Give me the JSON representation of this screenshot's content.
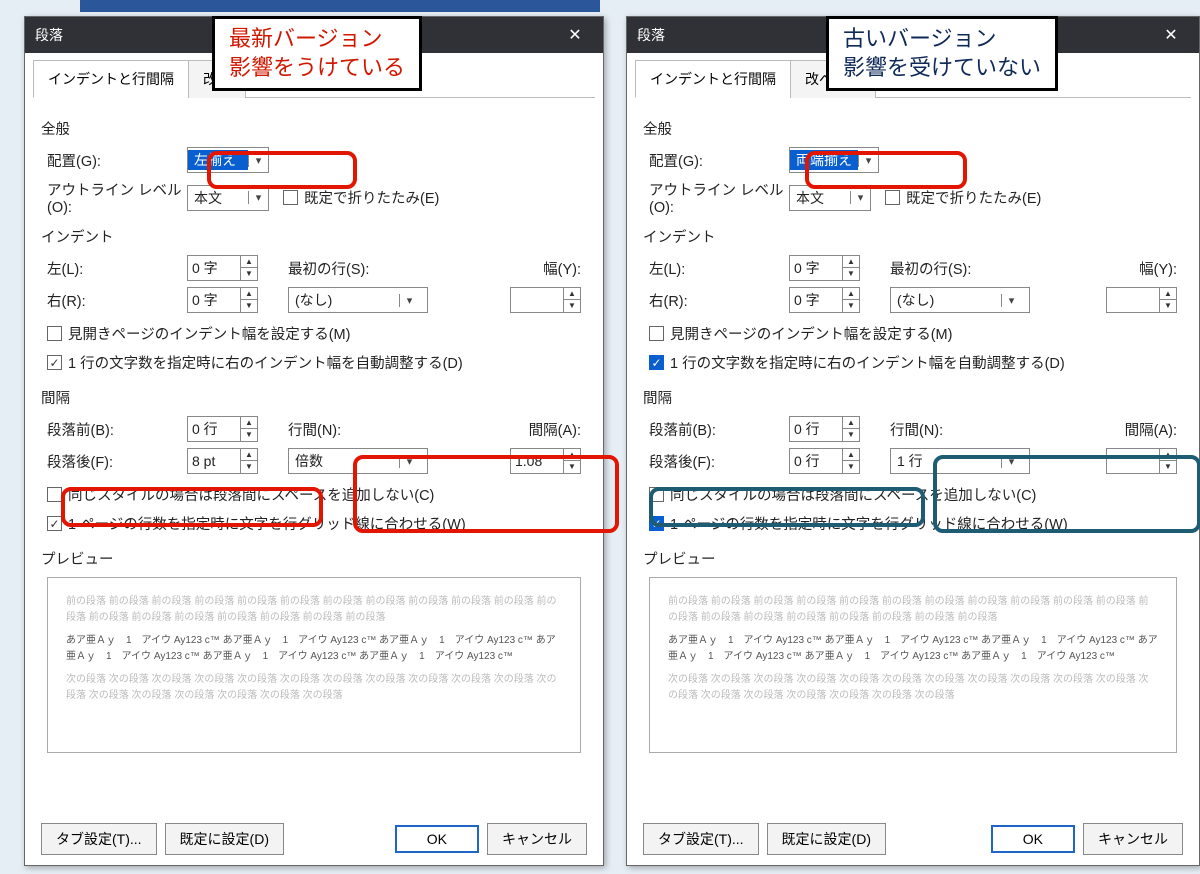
{
  "annot_left": "最新バージョン\n影響をうけている",
  "annot_right": "古いバージョン\n影響を受けていない",
  "title": "段落",
  "close_glyph": "✕",
  "tabs": {
    "t1": "インデントと行間隔",
    "t2_left": "改ぺ",
    "t2_right": "改ペーシ"
  },
  "sec": {
    "general": "全般",
    "indent": "インデント",
    "spacing": "間隔",
    "preview": "プレビュー"
  },
  "labels": {
    "align": "配置(G):",
    "outline": "アウトライン レベル(O):",
    "collapse": "既定で折りたたみ(E)",
    "left": "左(L):",
    "right": "右(R):",
    "firstline": "最初の行(S):",
    "width": "幅(Y):",
    "mirror": "見開きページのインデント幅を設定する(M)",
    "autoadjust": "1 行の文字数を指定時に右のインデント幅を自動調整する(D)",
    "before": "段落前(B):",
    "after": "段落後(F):",
    "linespace": "行間(N):",
    "interval": "間隔(A):",
    "nospace": "同じスタイルの場合は段落間にスペースを追加しない(C)",
    "snapgrid": "1 ページの行数を指定時に文字を行グリッド線に合わせる(W)"
  },
  "left": {
    "align": "左揃え",
    "outline": "本文",
    "indent_l": "0 字",
    "indent_r": "0 字",
    "firstline": "(なし)",
    "width": "",
    "before": "0 行",
    "after": "8 pt",
    "linespace": "倍数",
    "interval": "1.08",
    "chk_mirror": false,
    "chk_auto": true,
    "chk_auto_style": "gray",
    "chk_nospace": false,
    "chk_snap": true,
    "chk_snap_style": "gray",
    "chk_collapse": false
  },
  "right": {
    "align": "両端揃え",
    "outline": "本文",
    "indent_l": "0 字",
    "indent_r": "0 字",
    "firstline": "(なし)",
    "width": "",
    "before": "0 行",
    "after": "0 行",
    "linespace": "1 行",
    "interval": "",
    "chk_mirror": false,
    "chk_auto": true,
    "chk_auto_style": "blue",
    "chk_nospace": false,
    "chk_snap": true,
    "chk_snap_style": "blue",
    "chk_collapse": false
  },
  "preview": {
    "gray1": "前の段落 前の段落 前の段落 前の段落 前の段落 前の段落 前の段落 前の段落 前の段落 前の段落 前の段落 前の段落 前の段落 前の段落 前の段落 前の段落 前の段落 前の段落 前の段落",
    "dark": "あア亜Ａｙ　1　アイウ Ay123 c™ あア亜Ａｙ　1　アイウ Ay123 c™ あア亜Ａｙ　1　アイウ Ay123 c™ あア亜Ａｙ　1　アイウ Ay123 c™ あア亜Ａｙ　1　アイウ Ay123 c™ あア亜Ａｙ　1　アイウ Ay123 c™",
    "gray2": "次の段落 次の段落 次の段落 次の段落 次の段落 次の段落 次の段落 次の段落 次の段落 次の段落 次の段落 次の段落 次の段落 次の段落 次の段落 次の段落 次の段落 次の段落"
  },
  "footer": {
    "tabs": "タブ設定(T)...",
    "default": "既定に設定(D)",
    "ok": "OK",
    "cancel": "キャンセル"
  }
}
